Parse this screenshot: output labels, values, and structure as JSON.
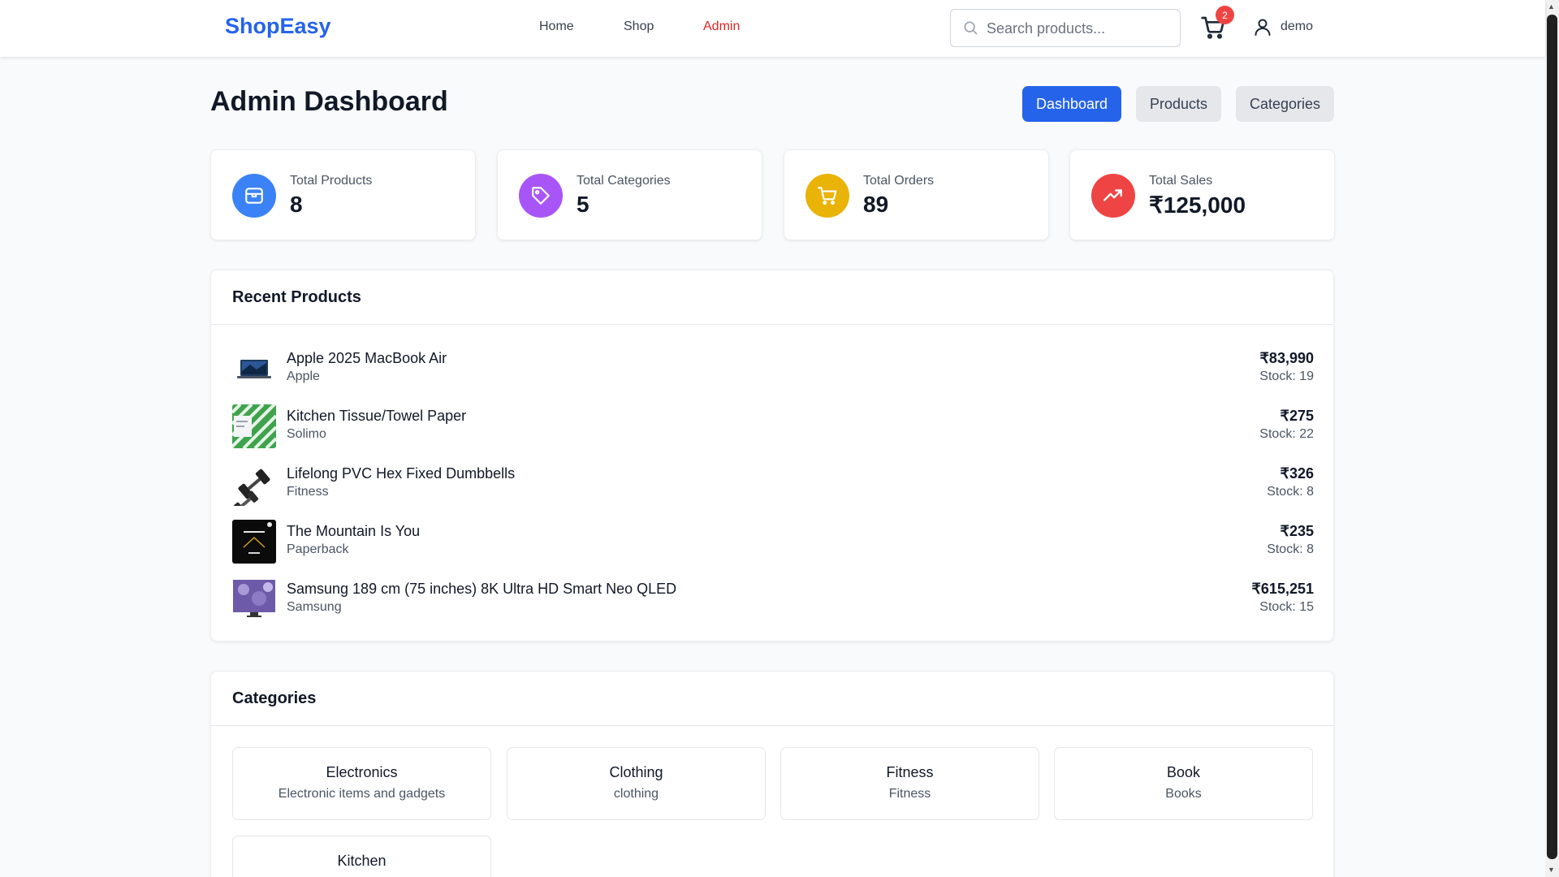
{
  "header": {
    "logo": "ShopEasy",
    "nav": {
      "home": "Home",
      "shop": "Shop",
      "admin": "Admin"
    },
    "search_placeholder": "Search products...",
    "cart_count": "2",
    "username": "demo"
  },
  "page": {
    "title": "Admin Dashboard",
    "tabs": {
      "dashboard": "Dashboard",
      "products": "Products",
      "categories": "Categories"
    }
  },
  "stats": {
    "products": {
      "label": "Total Products",
      "value": "8",
      "color": "#3b82f6",
      "icon": "box-icon"
    },
    "categories": {
      "label": "Total Categories",
      "value": "5",
      "color": "#a855f7",
      "icon": "tag-icon"
    },
    "orders": {
      "label": "Total Orders",
      "value": "89",
      "color": "#eab308",
      "icon": "cart-icon"
    },
    "sales": {
      "label": "Total Sales",
      "value": "₹125,000",
      "color": "#ef4444",
      "icon": "trending-up-icon"
    }
  },
  "recent_products": {
    "title": "Recent Products",
    "items": [
      {
        "name": "Apple 2025 MacBook Air",
        "sub": "Apple",
        "price": "₹83,990",
        "stock": "Stock: 19"
      },
      {
        "name": "Kitchen Tissue/Towel Paper",
        "sub": "Solimo",
        "price": "₹275",
        "stock": "Stock: 22"
      },
      {
        "name": "Lifelong PVC Hex Fixed Dumbbells",
        "sub": "Fitness",
        "price": "₹326",
        "stock": "Stock: 8"
      },
      {
        "name": "The Mountain Is You",
        "sub": "Paperback",
        "price": "₹235",
        "stock": "Stock: 8"
      },
      {
        "name": "Samsung 189 cm (75 inches) 8K Ultra HD Smart Neo QLED",
        "sub": "Samsung",
        "price": "₹615,251",
        "stock": "Stock: 15"
      }
    ]
  },
  "categories": {
    "title": "Categories",
    "items": [
      {
        "name": "Electronics",
        "desc": "Electronic items and gadgets"
      },
      {
        "name": "Clothing",
        "desc": "clothing"
      },
      {
        "name": "Fitness",
        "desc": "Fitness"
      },
      {
        "name": "Book",
        "desc": "Books"
      },
      {
        "name": "Kitchen",
        "desc": ""
      }
    ]
  }
}
